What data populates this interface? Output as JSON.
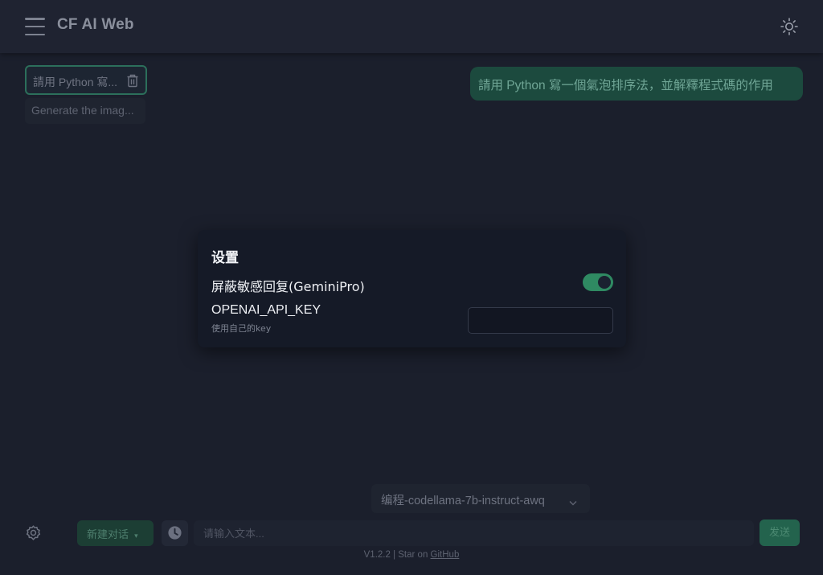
{
  "app": {
    "title": "CF AI Web"
  },
  "header": {
    "menu_icon": "hamburger-menu-icon",
    "theme_icon": "sun-icon"
  },
  "sidebar": {
    "history": [
      {
        "label": "請用 Python 寫...",
        "active": true,
        "icon": "trash-icon"
      },
      {
        "label": "Generate the imag...",
        "active": false
      }
    ]
  },
  "conversation": {
    "user_message": "請用 Python 寫一個氣泡排序法，並解釋程式碼的作用"
  },
  "settings_modal": {
    "title": "设置",
    "block_sensitive_label": "屏蔽敏感回复(GeminiPro)",
    "block_sensitive_enabled": true,
    "api_key_label": "OPENAI_API_KEY",
    "api_key_hint": "使用自己的key",
    "api_key_value": ""
  },
  "composer": {
    "model_selected": "编程-codellama-7b-instruct-awq",
    "new_chat_label": "新建对话",
    "input_placeholder": "请输入文本...",
    "send_label": "发送",
    "settings_icon": "gear-icon",
    "history_icon": "clock-icon"
  },
  "footer": {
    "version_text": "V1.2.2 | Star on",
    "link_text": "GitHub"
  },
  "colors": {
    "background": "#1b1f2c",
    "header": "#1f2331",
    "modal": "#151a27",
    "accent_green": "#2f8a62",
    "user_bubble": "#1c4a3e"
  }
}
